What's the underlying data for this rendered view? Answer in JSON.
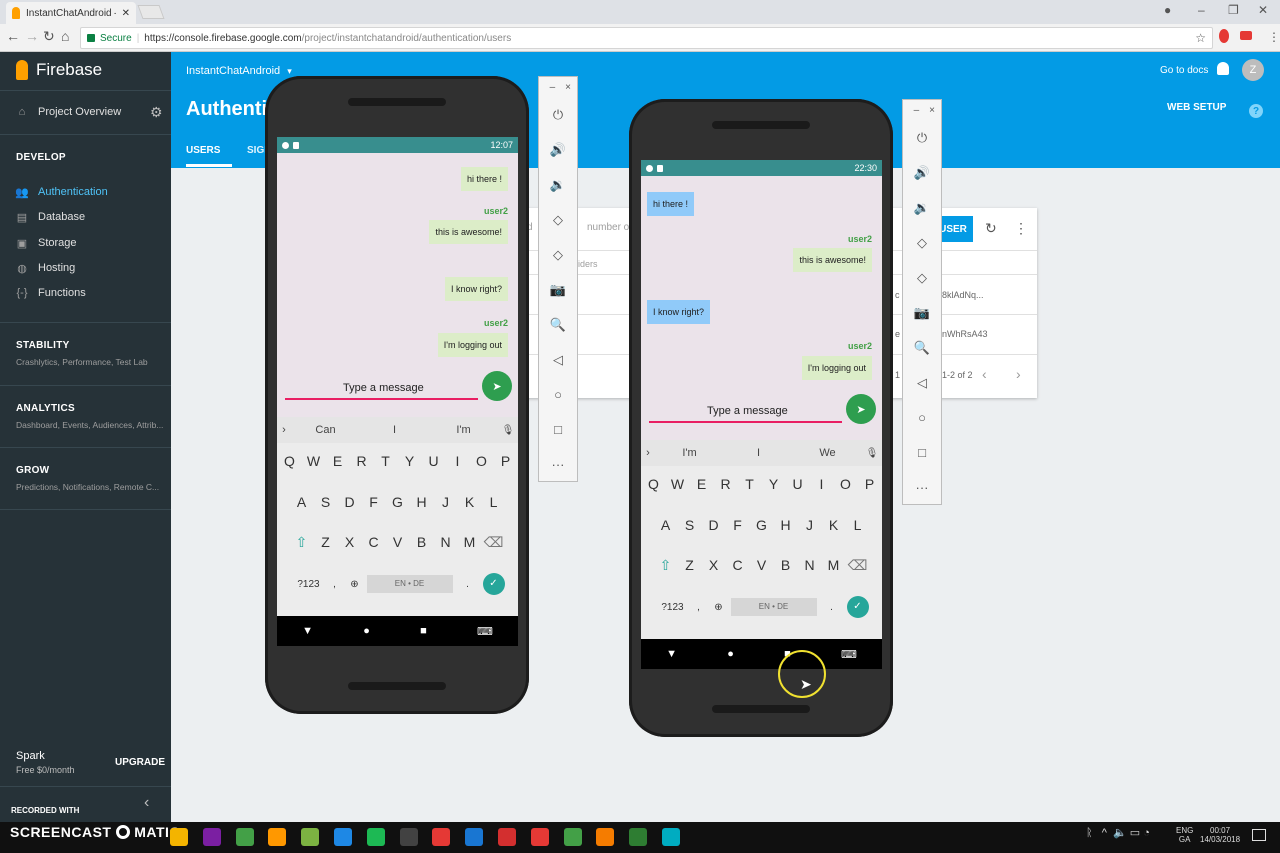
{
  "browser": {
    "tab_title": "InstantChatAndroid – Au",
    "tab_close": "✕",
    "secure_label": "Secure",
    "url_host": "https://console.firebase.google.com",
    "url_path": "/project/instantchatandroid/authentication/users",
    "win_account": "●",
    "win_min": "–",
    "win_restore": "❐",
    "win_close": "✕",
    "nav_back": "←",
    "nav_forward": "→",
    "nav_reload": "↻",
    "nav_home": "⌂",
    "bookmark": "☆"
  },
  "sidebar": {
    "brand": "Firebase",
    "project_overview": "Project Overview",
    "develop": "DEVELOP",
    "develop_items": [
      "Authentication",
      "Database",
      "Storage",
      "Hosting",
      "Functions"
    ],
    "develop_icons": [
      "people-icon",
      "database-icon",
      "image-icon",
      "globe-icon",
      "braces-icon"
    ],
    "develop_glyphs": [
      "👥",
      "▤",
      "▣",
      "◍",
      "{-}"
    ],
    "stability": "STABILITY",
    "stability_sub": "Crashlytics, Performance, Test Lab",
    "analytics": "ANALYTICS",
    "analytics_sub": "Dashboard, Events, Audiences, Attrib...",
    "grow": "GROW",
    "grow_sub": "Predictions, Notifications, Remote C...",
    "plan": "Spark",
    "plan_sub": "Free $0/month",
    "upgrade": "UPGRADE",
    "collapse": "‹"
  },
  "header": {
    "project": "InstantChatAndroid",
    "project_caret": "▾",
    "title": "Authentic",
    "tab_users": "USERS",
    "tab_sign": "SIGN",
    "go_to_docs": "Go to docs",
    "web_setup": "WEB SETUP",
    "avatar": "Z",
    "help": "?"
  },
  "users_card": {
    "search_placeholder": "number o",
    "search_prefix": "d",
    "add_user": "USER",
    "providers_header": "iders",
    "row1_uid": "8klAdNq...",
    "row1_prefix": "c",
    "row2_uid": "nWhRsA43",
    "row2_prefix": "e",
    "pagination": "1-2 of 2",
    "pagination_prefix": "1",
    "refresh": "↻",
    "more": "⋮",
    "prev": "‹",
    "next": "›"
  },
  "emulator_controls": {
    "buttons": [
      "⏻",
      "🔊",
      "🔉",
      "◇",
      "◇",
      "📷",
      "🔍",
      "◁",
      "○",
      "□",
      "···"
    ],
    "icons": [
      "power-icon",
      "volume-up-icon",
      "volume-down-icon",
      "rotate-left-icon",
      "rotate-right-icon",
      "camera-icon",
      "zoom-icon",
      "back-icon",
      "home-icon",
      "overview-icon",
      "more-icon"
    ],
    "minimize": "–",
    "close": "×"
  },
  "phone1": {
    "time": "12:07",
    "messages": [
      {
        "text": "hi there !",
        "mine": true
      },
      {
        "user": "user2"
      },
      {
        "text": "this is awesome!",
        "mine": true
      },
      {
        "text": "I know right?",
        "mine": true
      },
      {
        "user": "user2"
      },
      {
        "text": "I'm logging out",
        "mine": true
      }
    ],
    "composer_placeholder": "Type a message",
    "suggestions": [
      "Can",
      "I",
      "I'm"
    ]
  },
  "phone2": {
    "time": "22:30",
    "messages": [
      {
        "text": "hi there !",
        "mine": false
      },
      {
        "user": "user2"
      },
      {
        "text": "this is awesome!",
        "mine": true
      },
      {
        "text": "I know right?",
        "mine": false
      },
      {
        "user": "user2"
      },
      {
        "text": "I'm logging out",
        "mine": true
      }
    ],
    "composer_placeholder": "Type a message",
    "suggestions": [
      "I'm",
      "I",
      "We"
    ]
  },
  "keyboard": {
    "row1": [
      "Q",
      "W",
      "E",
      "R",
      "T",
      "Y",
      "U",
      "I",
      "O",
      "P"
    ],
    "row2": [
      "A",
      "S",
      "D",
      "F",
      "G",
      "H",
      "J",
      "K",
      "L"
    ],
    "row3": [
      "Z",
      "X",
      "C",
      "V",
      "B",
      "N",
      "M"
    ],
    "shift": "⇧",
    "backspace": "⌫",
    "symbols": "?123",
    "comma": ",",
    "space": "EN • DE",
    "period": ".",
    "enter": "✓",
    "sugg_arrow": "›",
    "mic": "🎙"
  },
  "android_nav": {
    "back": "▼",
    "home": "●",
    "recents": "■",
    "kbd": "⌨"
  },
  "send_glyph": "➤",
  "taskbar": {
    "recorded_with": "RECORDED WITH",
    "screencast": "SCREENCAST",
    "matic": "MATIC",
    "lang1": "ENG",
    "lang2": "GA",
    "time": "00:07",
    "date": "14/03/2018",
    "icon_colors": [
      "#ffffff",
      "#ffffff",
      "#f4b400",
      "#7b1fa2",
      "#43a047",
      "#ff9800",
      "#7cb342",
      "#1e88e5",
      "#1db954",
      "#424242",
      "#e53935",
      "#1976d2",
      "#d32f2f",
      "#e53935",
      "#43a047",
      "#f57c00",
      "#2e7d32",
      "#00acc1"
    ]
  },
  "colors": {
    "firebase_blue": "#039be5",
    "sidebar": "#263238",
    "accent_light_blue": "#4fc3f7",
    "firebase_orange": "#ffa000"
  }
}
